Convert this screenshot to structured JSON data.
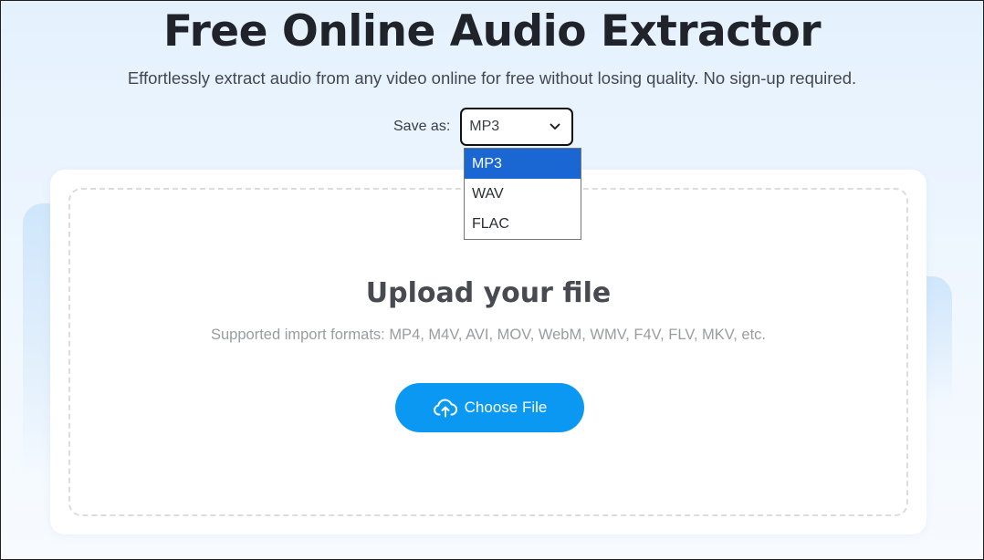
{
  "header": {
    "title": "Free Online Audio Extractor",
    "subtitle": "Effortlessly extract audio from any video online for free without losing quality. No sign-up required."
  },
  "save_as": {
    "label": "Save as:",
    "selected": "MP3",
    "options": [
      "MP3",
      "WAV",
      "FLAC"
    ]
  },
  "upload": {
    "title": "Upload your file",
    "formats": "Supported import formats: MP4, M4V, AVI, MOV, WebM, WMV, F4V, FLV, MKV, etc.",
    "button_label": "Choose File",
    "button_icon": "cloud-upload-icon"
  },
  "colors": {
    "accent": "#0a98f2",
    "selected_option": "#1a66d2",
    "title": "#20232a"
  }
}
